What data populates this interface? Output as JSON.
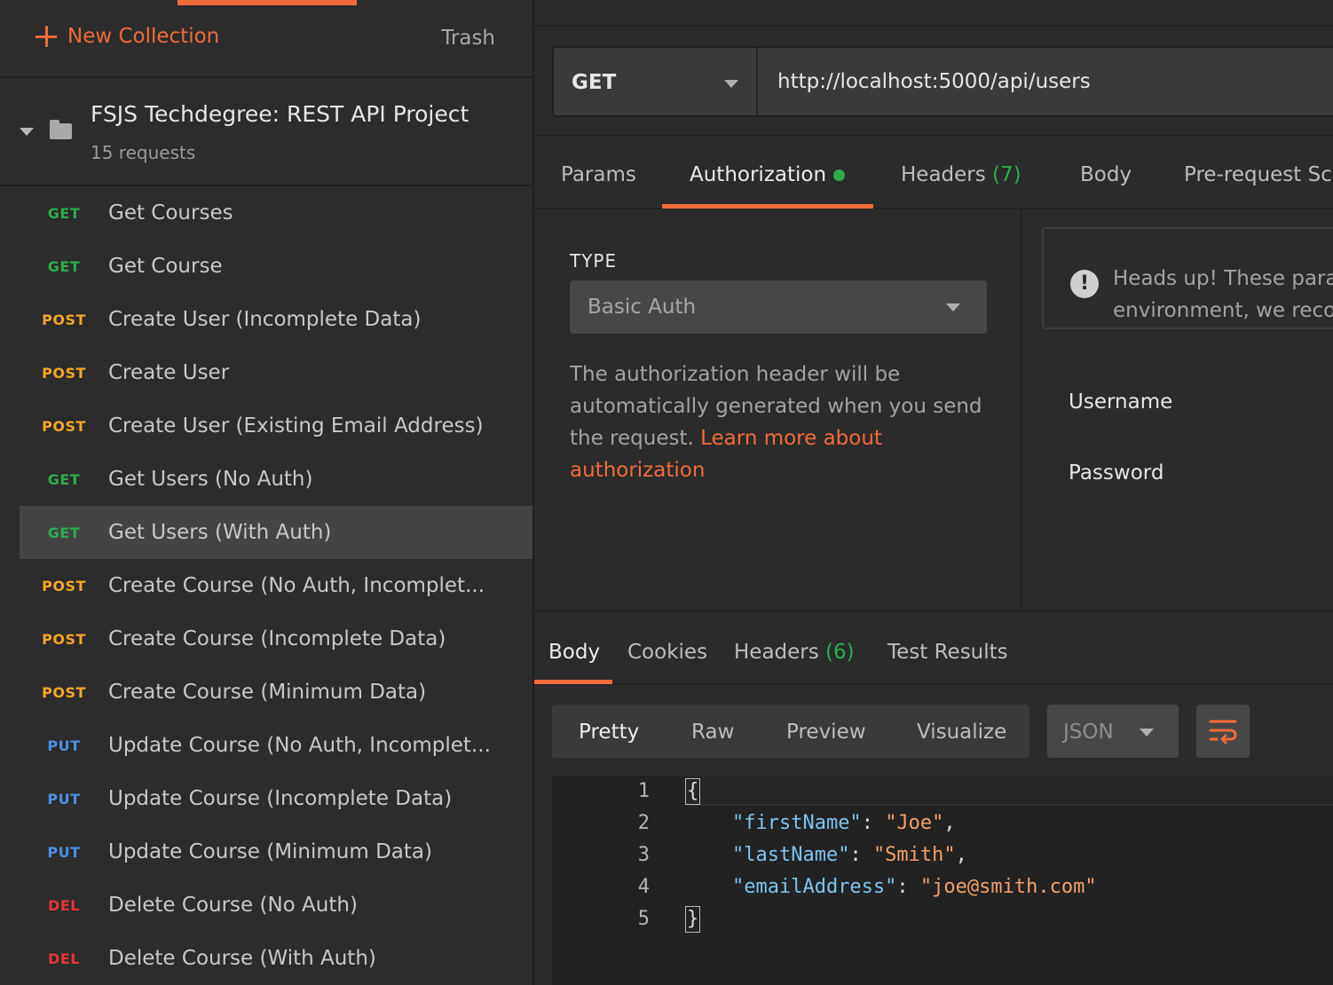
{
  "sidebar": {
    "new_collection_label": "New Collection",
    "trash_label": "Trash",
    "collection": {
      "title": "FSJS Techdegree: REST API Project",
      "count": "15 requests"
    },
    "requests": [
      {
        "method": "GET",
        "name": "Get Courses"
      },
      {
        "method": "GET",
        "name": "Get Course"
      },
      {
        "method": "POST",
        "name": "Create User (Incomplete Data)"
      },
      {
        "method": "POST",
        "name": "Create User"
      },
      {
        "method": "POST",
        "name": "Create User (Existing Email Address)"
      },
      {
        "method": "GET",
        "name": "Get Users (No Auth)"
      },
      {
        "method": "GET",
        "name": "Get Users (With Auth)"
      },
      {
        "method": "POST",
        "name": "Create Course (No Auth, Incomplet..."
      },
      {
        "method": "POST",
        "name": "Create Course (Incomplete Data)"
      },
      {
        "method": "POST",
        "name": "Create Course (Minimum Data)"
      },
      {
        "method": "PUT",
        "name": "Update Course (No Auth, Incomplet..."
      },
      {
        "method": "PUT",
        "name": "Update Course (Incomplete Data)"
      },
      {
        "method": "PUT",
        "name": "Update Course (Minimum Data)"
      },
      {
        "method": "DEL",
        "name": "Delete Course (No Auth)"
      },
      {
        "method": "DEL",
        "name": "Delete Course (With Auth)"
      }
    ]
  },
  "request": {
    "method": "GET",
    "url": "http://localhost:5000/api/users",
    "tabs": {
      "params": "Params",
      "authorization": "Authorization",
      "headers": "Headers",
      "headers_count": "(7)",
      "body": "Body",
      "prerequest": "Pre-request Scr"
    }
  },
  "auth": {
    "type_label": "TYPE",
    "type_value": "Basic Auth",
    "description": "The authorization header will be automatically generated when you send the request. ",
    "link_text": "Learn more about authorization",
    "headsup_line1": "Heads up! These parar",
    "headsup_line2": "environment, we recor",
    "username_label": "Username",
    "password_label": "Password"
  },
  "response": {
    "tabs": {
      "body": "Body",
      "cookies": "Cookies",
      "headers": "Headers",
      "headers_count": "(6)",
      "tests": "Test Results"
    },
    "views": {
      "pretty": "Pretty",
      "raw": "Raw",
      "preview": "Preview",
      "visualize": "Visualize"
    },
    "language": "JSON",
    "line_numbers": [
      "1",
      "2",
      "3",
      "4",
      "5"
    ],
    "json": {
      "open": "{",
      "k1": "\"firstName\"",
      "v1": "\"Joe\"",
      "k2": "\"lastName\"",
      "v2": "\"Smith\"",
      "k3": "\"emailAddress\"",
      "v3": "\"joe@smith.com\"",
      "close": "}"
    }
  },
  "colors": {
    "accent": "#f26b3a",
    "get": "#2eac4d",
    "post": "#f5a623",
    "put": "#4a90e2",
    "del": "#e8363a"
  }
}
